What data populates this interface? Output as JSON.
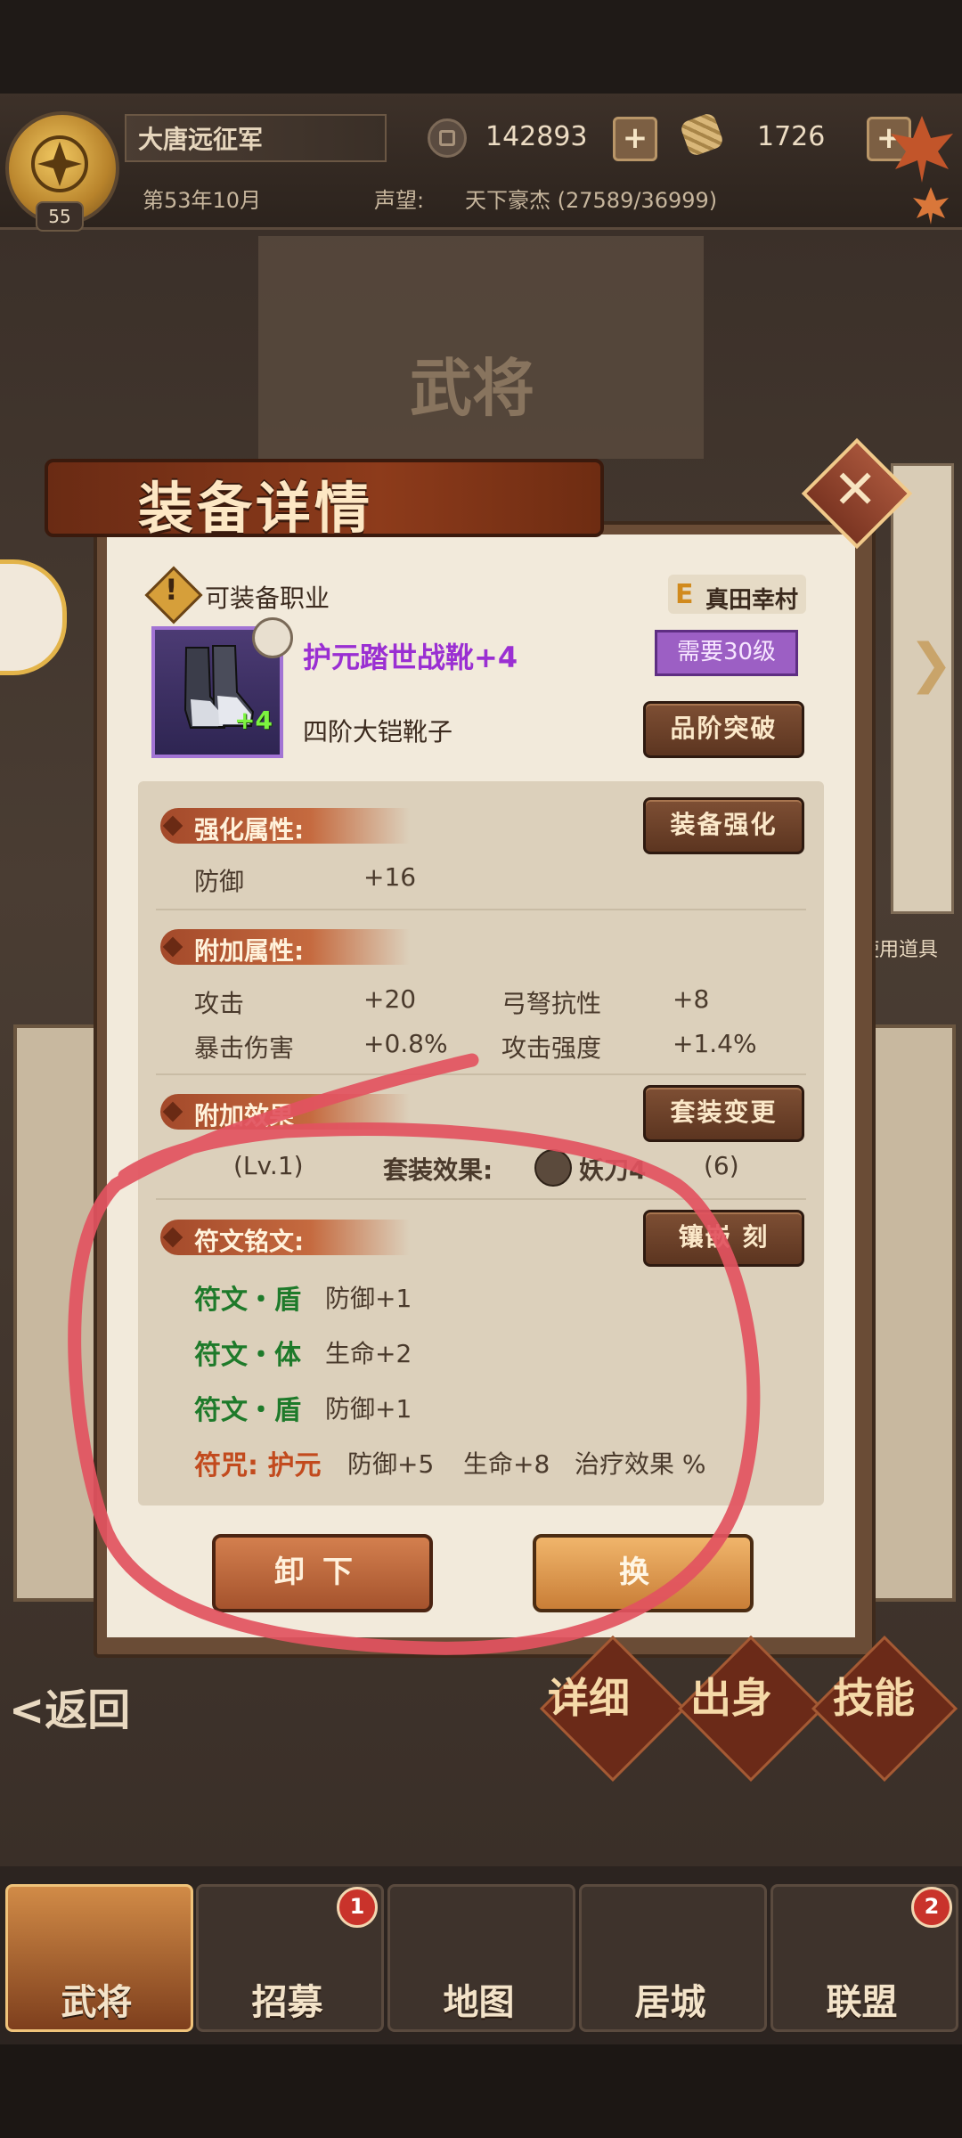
{
  "header": {
    "level": "55",
    "clan_name": "大唐远征军",
    "coins": "142893",
    "gold": "1726",
    "date": "第53年10月",
    "reputation_label": "声望:",
    "reputation_value": "天下豪杰 (27589/36999)",
    "plus_label": "+"
  },
  "background": {
    "page_title": "武将",
    "use_item_label": "使用道具"
  },
  "modal": {
    "title": "装备详情",
    "close_label": "✕",
    "job_label": "可装备职业",
    "char_grade": "E",
    "char_name": "真田幸村",
    "item_name": "护元踏世战靴+4",
    "item_plus": "+4",
    "required_level": "需要30级",
    "item_type": "四阶大铠靴子",
    "breakthrough_button": "品阶突破",
    "enhance_section": {
      "title": "强化属性:",
      "button": "装备强化",
      "stats": [
        {
          "name": "防御",
          "value": "+16"
        }
      ]
    },
    "extra_section": {
      "title": "附加属性:",
      "stats": [
        {
          "name": "攻击",
          "value": "+20"
        },
        {
          "name": "弓弩抗性",
          "value": "+8"
        },
        {
          "name": "暴击伤害",
          "value": "+0.8%"
        },
        {
          "name": "攻击强度",
          "value": "+1.4%"
        }
      ]
    },
    "effect_section": {
      "title": "附加效果",
      "button": "套装变更",
      "level_text": "(Lv.1)",
      "set_label": "套装效果:",
      "set_value": "妖刀4",
      "set_count": "(6)"
    },
    "rune_section": {
      "title": "符文铭文:",
      "button": "镶嵌 刻",
      "runes": [
        {
          "name": "符文・盾",
          "effect": "防御+1"
        },
        {
          "name": "符文・体",
          "effect": "生命+2"
        },
        {
          "name": "符文・盾",
          "effect": "防御+1"
        }
      ],
      "curse_name": "符咒: 护元",
      "curse_effects": [
        "防御+5",
        "生命+8",
        "治疗效果 %"
      ]
    },
    "unequip_button": "卸下",
    "replace_button": "换"
  },
  "footer": {
    "back_label": "<返回",
    "tabs": [
      "详细",
      "出身",
      "技能"
    ]
  },
  "nav": {
    "items": [
      {
        "label": "武将",
        "badge": ""
      },
      {
        "label": "招募",
        "badge": "1"
      },
      {
        "label": "地图",
        "badge": ""
      },
      {
        "label": "居城",
        "badge": ""
      },
      {
        "label": "联盟",
        "badge": "2"
      }
    ]
  }
}
